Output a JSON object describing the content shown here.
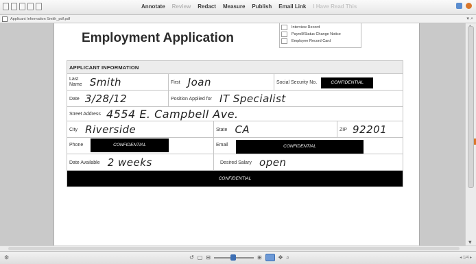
{
  "menubar": {
    "items": [
      {
        "label": "Annotate",
        "state": "on"
      },
      {
        "label": "Review",
        "state": "off"
      },
      {
        "label": "Redact",
        "state": "on"
      },
      {
        "label": "Measure",
        "state": "on"
      },
      {
        "label": "Publish",
        "state": "on"
      },
      {
        "label": "Email Link",
        "state": "on"
      },
      {
        "label": "I Have Read This",
        "state": "faint"
      }
    ],
    "separator": "▾"
  },
  "tabbar": {
    "document_tab": "Applicant Information Smith_pdf.pdf",
    "right_glyph": "▾ ⌕"
  },
  "page": {
    "title": "Employment Application",
    "office_use": [
      "Interview Record",
      "Payroll/Status Change Notice",
      "Employee Record Card"
    ],
    "section_header": "APPLICANT INFORMATION",
    "fields": {
      "last_name_label": "Last Name",
      "last_name_label_l1": "Last",
      "last_name_label_l2": "Name",
      "last_name": "Smith",
      "first_label": "First",
      "first": "Joan",
      "ssn_label": "Social Security No.",
      "ssn_value": "CONFIDENTIAL",
      "date_label": "Date",
      "date": "3/28/12",
      "position_label": "Position Applied for",
      "position": "IT Specialist",
      "street_label": "Street Address",
      "street": "4554 E. Campbell Ave.",
      "city_label": "City",
      "city": "Riverside",
      "state_label": "State",
      "state": "CA",
      "zip_label": "ZIP",
      "zip": "92201",
      "phone_label": "Phone",
      "phone_value": "CONFIDENTIAL",
      "email_label": "Email",
      "email_value": "CONFIDENTIAL",
      "date_available_label": "Date Available",
      "date_available": "2 weeks",
      "desired_salary_label": "Desired Salary",
      "desired_salary": "open",
      "redacted_block": "CONFIDENTIAL"
    }
  },
  "statusbar": {
    "page_indicator": "1/4"
  },
  "colors": {
    "redaction": "#000000",
    "accent": "#3d6eb3"
  }
}
